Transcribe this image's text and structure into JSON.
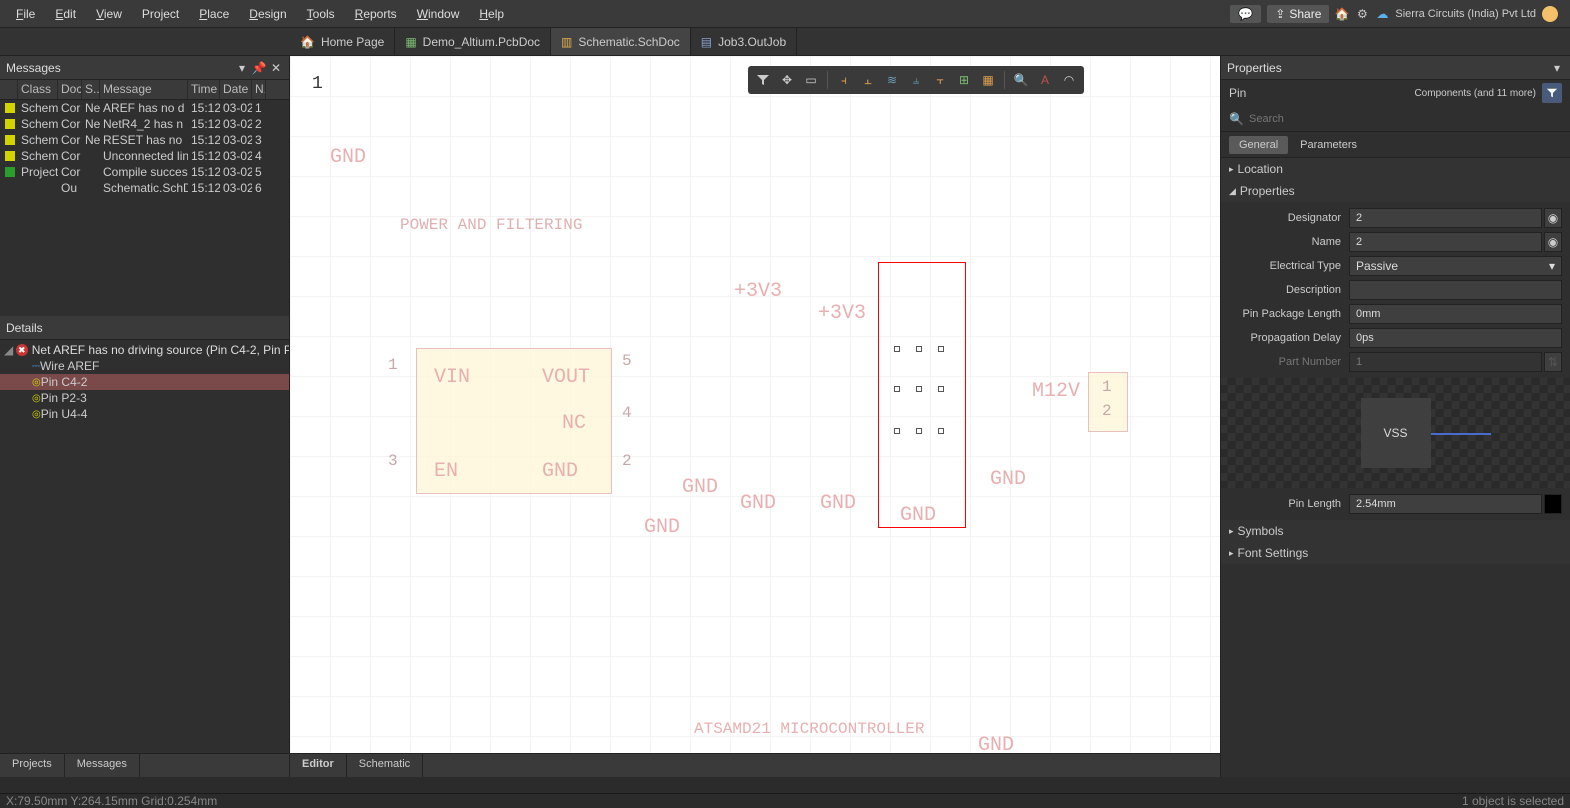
{
  "menu": [
    "File",
    "Edit",
    "View",
    "Project",
    "Place",
    "Design",
    "Tools",
    "Reports",
    "Window",
    "Help"
  ],
  "share_label": "Share",
  "company": "Sierra Circuits (India) Pvt Ltd",
  "doc_tabs": [
    {
      "label": "Home Page",
      "icon": "home",
      "active": false
    },
    {
      "label": "Demo_Altium.PcbDoc",
      "icon": "pcb",
      "active": false
    },
    {
      "label": "Schematic.SchDoc",
      "icon": "sch",
      "active": true
    },
    {
      "label": "Job3.OutJob",
      "icon": "job",
      "active": false
    }
  ],
  "messages_panel": {
    "title": "Messages",
    "columns": [
      "Class",
      "Doc...",
      "S...",
      "Message",
      "Time",
      "Date",
      "N..."
    ],
    "rows": [
      {
        "color": "yellow",
        "class": "Schem",
        "doc": "Cor",
        "src": "Net",
        "msg": "AREF has no d",
        "time": "15:12:",
        "date": "03-02",
        "no": "1"
      },
      {
        "color": "yellow",
        "class": "Schem",
        "doc": "Cor",
        "src": "Net",
        "msg": "NetR4_2 has n",
        "time": "15:12:",
        "date": "03-02",
        "no": "2"
      },
      {
        "color": "yellow",
        "class": "Schem",
        "doc": "Cor",
        "src": "Net",
        "msg": "RESET has no",
        "time": "15:12:",
        "date": "03-02",
        "no": "3"
      },
      {
        "color": "yellow",
        "class": "Schem",
        "doc": "Cor",
        "src": "",
        "msg": "Unconnected line",
        "time": "15:12:",
        "date": "03-02",
        "no": "4"
      },
      {
        "color": "green",
        "class": "Project",
        "doc": "Cor",
        "src": "",
        "msg": "Compile successfu",
        "time": "15:12:",
        "date": "03-02",
        "no": "5"
      },
      {
        "color": "",
        "class": "",
        "doc": "Ou",
        "src": "",
        "msg": "Schematic.SchDoc",
        "time": "15:12:",
        "date": "03-02",
        "no": "6"
      }
    ]
  },
  "details_panel": {
    "title": "Details",
    "root": "Net AREF has no driving source (Pin C4-2, Pin P",
    "children": [
      {
        "icon": "wire",
        "label": "Wire AREF",
        "selected": false
      },
      {
        "icon": "pin",
        "label": "Pin C4-2",
        "selected": true
      },
      {
        "icon": "pin",
        "label": "Pin P2-3",
        "selected": false
      },
      {
        "icon": "pin",
        "label": "Pin U4-4",
        "selected": false
      }
    ]
  },
  "left_tabs": [
    "Projects",
    "Messages"
  ],
  "editor_tabs": [
    "Editor",
    "Schematic"
  ],
  "schematic": {
    "page_num": "1",
    "title_power": "POWER AND FILTERING",
    "title_mcu": "ATSAMD21 MICROCONTROLLER",
    "labels": {
      "gnd": "GND",
      "v3": "+3V3",
      "vin": "VIN",
      "vout": "VOUT",
      "nc": "NC",
      "en": "EN",
      "m12v": "M12V"
    },
    "pin_nums": {
      "p1": "1",
      "p2": "2",
      "p3": "3",
      "p4": "4",
      "p5": "5"
    }
  },
  "properties": {
    "title": "Properties",
    "object_type": "Pin",
    "object_scope": "Components (and 11 more)",
    "search_placeholder": "Search",
    "tabs": [
      "General",
      "Parameters"
    ],
    "sections": {
      "location": "Location",
      "properties": "Properties",
      "symbols": "Symbols",
      "font": "Font Settings"
    },
    "fields": {
      "designator": {
        "label": "Designator",
        "value": "2"
      },
      "name": {
        "label": "Name",
        "value": "2"
      },
      "electrical_type": {
        "label": "Electrical Type",
        "value": "Passive"
      },
      "description": {
        "label": "Description",
        "value": ""
      },
      "pin_pkg_len": {
        "label": "Pin Package Length",
        "value": "0mm"
      },
      "prop_delay": {
        "label": "Propagation Delay",
        "value": "0ps"
      },
      "part_number": {
        "label": "Part Number",
        "value": "1"
      },
      "pin_length": {
        "label": "Pin Length",
        "value": "2.54mm"
      }
    },
    "preview_label": "VSS"
  },
  "status": {
    "left": "X:79.50mm Y:264.15mm   Grid:0.254mm",
    "right": "1 object is selected"
  }
}
